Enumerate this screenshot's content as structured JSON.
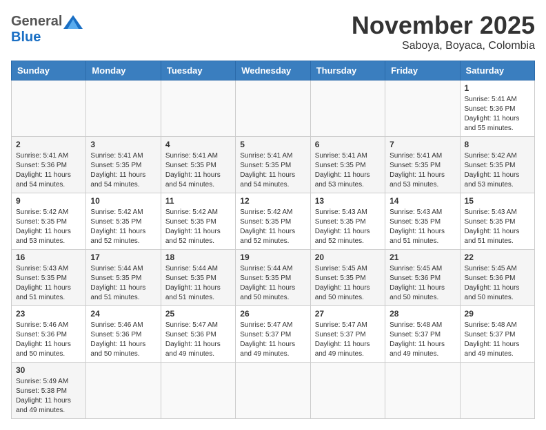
{
  "header": {
    "logo_general": "General",
    "logo_blue": "Blue",
    "month_title": "November 2025",
    "location": "Saboya, Boyaca, Colombia"
  },
  "days_of_week": [
    "Sunday",
    "Monday",
    "Tuesday",
    "Wednesday",
    "Thursday",
    "Friday",
    "Saturday"
  ],
  "weeks": [
    {
      "row_style": "odd",
      "days": [
        {
          "number": "",
          "info": ""
        },
        {
          "number": "",
          "info": ""
        },
        {
          "number": "",
          "info": ""
        },
        {
          "number": "",
          "info": ""
        },
        {
          "number": "",
          "info": ""
        },
        {
          "number": "",
          "info": ""
        },
        {
          "number": "1",
          "info": "Sunrise: 5:41 AM\nSunset: 5:36 PM\nDaylight: 11 hours\nand 55 minutes."
        }
      ]
    },
    {
      "row_style": "even",
      "days": [
        {
          "number": "2",
          "info": "Sunrise: 5:41 AM\nSunset: 5:36 PM\nDaylight: 11 hours\nand 54 minutes."
        },
        {
          "number": "3",
          "info": "Sunrise: 5:41 AM\nSunset: 5:35 PM\nDaylight: 11 hours\nand 54 minutes."
        },
        {
          "number": "4",
          "info": "Sunrise: 5:41 AM\nSunset: 5:35 PM\nDaylight: 11 hours\nand 54 minutes."
        },
        {
          "number": "5",
          "info": "Sunrise: 5:41 AM\nSunset: 5:35 PM\nDaylight: 11 hours\nand 54 minutes."
        },
        {
          "number": "6",
          "info": "Sunrise: 5:41 AM\nSunset: 5:35 PM\nDaylight: 11 hours\nand 53 minutes."
        },
        {
          "number": "7",
          "info": "Sunrise: 5:41 AM\nSunset: 5:35 PM\nDaylight: 11 hours\nand 53 minutes."
        },
        {
          "number": "8",
          "info": "Sunrise: 5:42 AM\nSunset: 5:35 PM\nDaylight: 11 hours\nand 53 minutes."
        }
      ]
    },
    {
      "row_style": "odd",
      "days": [
        {
          "number": "9",
          "info": "Sunrise: 5:42 AM\nSunset: 5:35 PM\nDaylight: 11 hours\nand 53 minutes."
        },
        {
          "number": "10",
          "info": "Sunrise: 5:42 AM\nSunset: 5:35 PM\nDaylight: 11 hours\nand 52 minutes."
        },
        {
          "number": "11",
          "info": "Sunrise: 5:42 AM\nSunset: 5:35 PM\nDaylight: 11 hours\nand 52 minutes."
        },
        {
          "number": "12",
          "info": "Sunrise: 5:42 AM\nSunset: 5:35 PM\nDaylight: 11 hours\nand 52 minutes."
        },
        {
          "number": "13",
          "info": "Sunrise: 5:43 AM\nSunset: 5:35 PM\nDaylight: 11 hours\nand 52 minutes."
        },
        {
          "number": "14",
          "info": "Sunrise: 5:43 AM\nSunset: 5:35 PM\nDaylight: 11 hours\nand 51 minutes."
        },
        {
          "number": "15",
          "info": "Sunrise: 5:43 AM\nSunset: 5:35 PM\nDaylight: 11 hours\nand 51 minutes."
        }
      ]
    },
    {
      "row_style": "even",
      "days": [
        {
          "number": "16",
          "info": "Sunrise: 5:43 AM\nSunset: 5:35 PM\nDaylight: 11 hours\nand 51 minutes."
        },
        {
          "number": "17",
          "info": "Sunrise: 5:44 AM\nSunset: 5:35 PM\nDaylight: 11 hours\nand 51 minutes."
        },
        {
          "number": "18",
          "info": "Sunrise: 5:44 AM\nSunset: 5:35 PM\nDaylight: 11 hours\nand 51 minutes."
        },
        {
          "number": "19",
          "info": "Sunrise: 5:44 AM\nSunset: 5:35 PM\nDaylight: 11 hours\nand 50 minutes."
        },
        {
          "number": "20",
          "info": "Sunrise: 5:45 AM\nSunset: 5:35 PM\nDaylight: 11 hours\nand 50 minutes."
        },
        {
          "number": "21",
          "info": "Sunrise: 5:45 AM\nSunset: 5:36 PM\nDaylight: 11 hours\nand 50 minutes."
        },
        {
          "number": "22",
          "info": "Sunrise: 5:45 AM\nSunset: 5:36 PM\nDaylight: 11 hours\nand 50 minutes."
        }
      ]
    },
    {
      "row_style": "odd",
      "days": [
        {
          "number": "23",
          "info": "Sunrise: 5:46 AM\nSunset: 5:36 PM\nDaylight: 11 hours\nand 50 minutes."
        },
        {
          "number": "24",
          "info": "Sunrise: 5:46 AM\nSunset: 5:36 PM\nDaylight: 11 hours\nand 50 minutes."
        },
        {
          "number": "25",
          "info": "Sunrise: 5:47 AM\nSunset: 5:36 PM\nDaylight: 11 hours\nand 49 minutes."
        },
        {
          "number": "26",
          "info": "Sunrise: 5:47 AM\nSunset: 5:37 PM\nDaylight: 11 hours\nand 49 minutes."
        },
        {
          "number": "27",
          "info": "Sunrise: 5:47 AM\nSunset: 5:37 PM\nDaylight: 11 hours\nand 49 minutes."
        },
        {
          "number": "28",
          "info": "Sunrise: 5:48 AM\nSunset: 5:37 PM\nDaylight: 11 hours\nand 49 minutes."
        },
        {
          "number": "29",
          "info": "Sunrise: 5:48 AM\nSunset: 5:37 PM\nDaylight: 11 hours\nand 49 minutes."
        }
      ]
    },
    {
      "row_style": "even",
      "days": [
        {
          "number": "30",
          "info": "Sunrise: 5:49 AM\nSunset: 5:38 PM\nDaylight: 11 hours\nand 49 minutes."
        },
        {
          "number": "",
          "info": ""
        },
        {
          "number": "",
          "info": ""
        },
        {
          "number": "",
          "info": ""
        },
        {
          "number": "",
          "info": ""
        },
        {
          "number": "",
          "info": ""
        },
        {
          "number": "",
          "info": ""
        }
      ]
    }
  ]
}
